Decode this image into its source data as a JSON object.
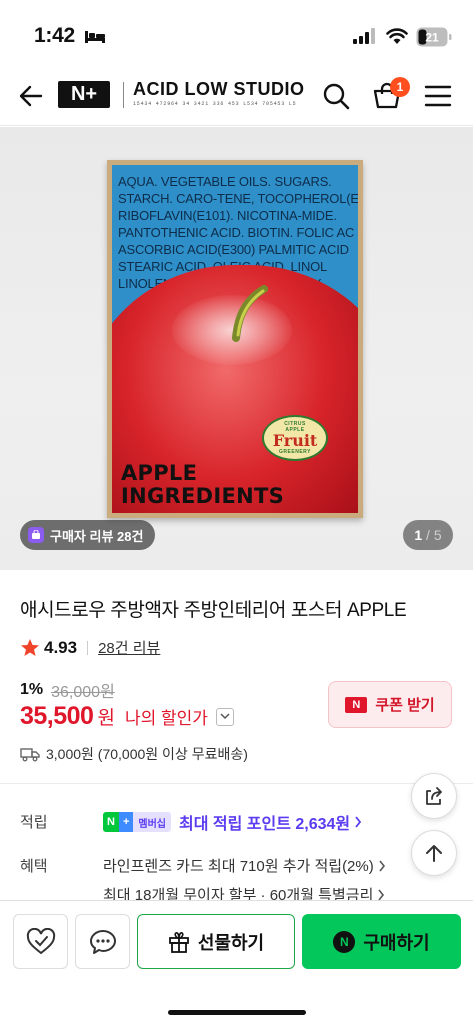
{
  "status_bar": {
    "time": "1:42",
    "battery": "21"
  },
  "header": {
    "logo_text": "N+",
    "brand_name": "ACID LOW STUDIO",
    "brand_sub": "15434 472964 34 3421 336 453 L534 705453 L5",
    "cart_count": "1"
  },
  "hero": {
    "poster": {
      "ingredients": "AQUA. VEGETABLE OILS. SUGARS.\nSTARCH. CARO-TENE, TOCOPHEROL(E\nRIBOFLAVIN(E101). NICOTINA-MIDE.\nPANTOTHENIC ACID. BIOTIN. FOLIC AC\nASCORBIC ACID(E300) PALMITIC ACID\nSTEARIC ACID. OLEIC ACID. LINOL\nLINOLENIC ACID. MALIC ACID. OX",
      "sticker_top": "CITRUS",
      "sticker_apple": "APPLE",
      "sticker_main": "Fruit",
      "sticker_bottom": "GREENERY",
      "title": "APPLE\nINGREDIENTS"
    },
    "review_pill": "구매자 리뷰 28건",
    "page_current": "1",
    "page_total": "/ 5"
  },
  "product": {
    "title": "애시드로우 주방액자 주방인테리어 포스터 APPLE",
    "rating": "4.93",
    "review_link": "28건 리뷰",
    "discount_rate": "1%",
    "original_price": "36,000원",
    "price": "35,500",
    "price_unit": "원",
    "my_discount": "나의 할인가",
    "coupon_label": "쿠폰 받기",
    "coupon_logo": "N",
    "shipping": "3,000원 (70,000원 이상 무료배송)"
  },
  "points": {
    "label": "적립",
    "badge_n": "N",
    "badge_plus": "+",
    "badge_member": "멤버십",
    "text": "최대 적립 포인트 2,634원"
  },
  "benefits": {
    "label": "혜택",
    "line1": "라인프렌즈 카드 최대 710원 추가 적립(2%)",
    "line2": "최대 18개월 무이자 할부 · 60개월 특별금리"
  },
  "bottom_bar": {
    "gift_label": "선물하기",
    "buy_label": "구매하기",
    "buy_logo": "N"
  },
  "colors": {
    "price_red": "#e0162b",
    "naver_green": "#03c75a",
    "points_purple": "#5b3cf0",
    "poster_blue": "#2f8fc8"
  }
}
